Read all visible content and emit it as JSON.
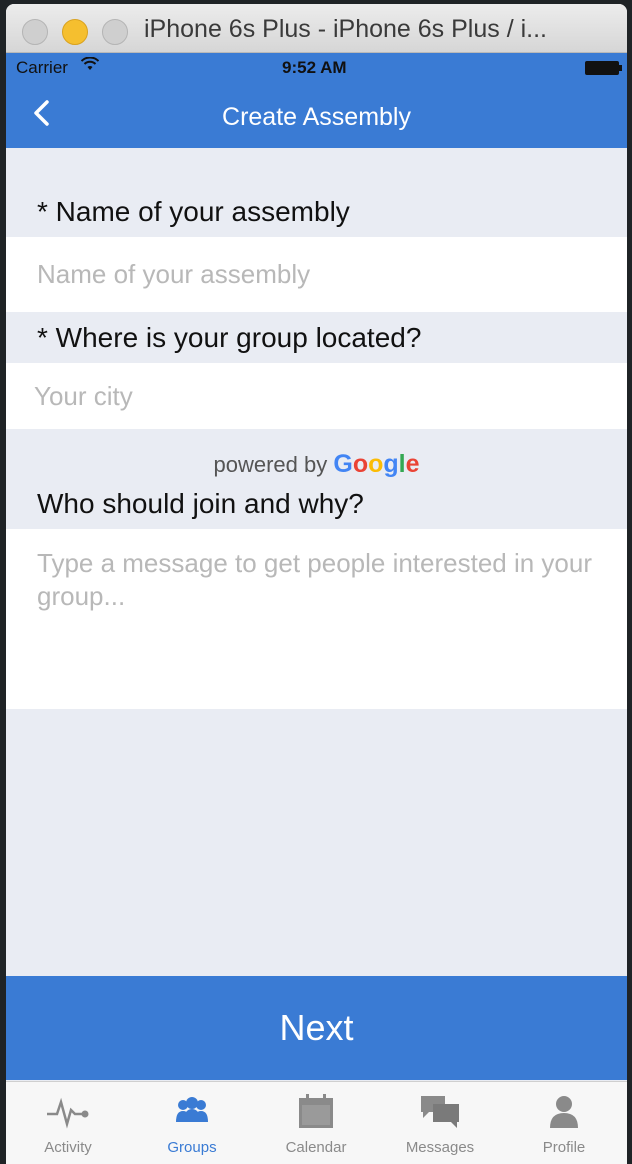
{
  "window": {
    "title": "iPhone 6s Plus - iPhone 6s Plus / i..."
  },
  "status_bar": {
    "carrier": "Carrier",
    "time": "9:52 AM"
  },
  "nav": {
    "title": "Create Assembly",
    "back_icon": "chevron-left-icon"
  },
  "form": {
    "name_label": "* Name of your assembly",
    "name_placeholder": "Name of your assembly",
    "location_label": "* Where is your group located?",
    "location_placeholder": "Your city",
    "powered_by": "powered by",
    "powered_brand": "Google",
    "why_label": "Who should join and why?",
    "why_placeholder": "Type a message to get people interested in your group..."
  },
  "next_button": {
    "label": "Next"
  },
  "tabs": [
    {
      "label": "Activity",
      "icon": "activity-icon",
      "active": false
    },
    {
      "label": "Groups",
      "icon": "groups-icon",
      "active": true
    },
    {
      "label": "Calendar",
      "icon": "calendar-icon",
      "active": false
    },
    {
      "label": "Messages",
      "icon": "messages-icon",
      "active": false
    },
    {
      "label": "Profile",
      "icon": "profile-icon",
      "active": false
    }
  ],
  "colors": {
    "accent": "#3a7bd4",
    "background": "#e9ecf3",
    "placeholder": "#b8b8b8"
  }
}
